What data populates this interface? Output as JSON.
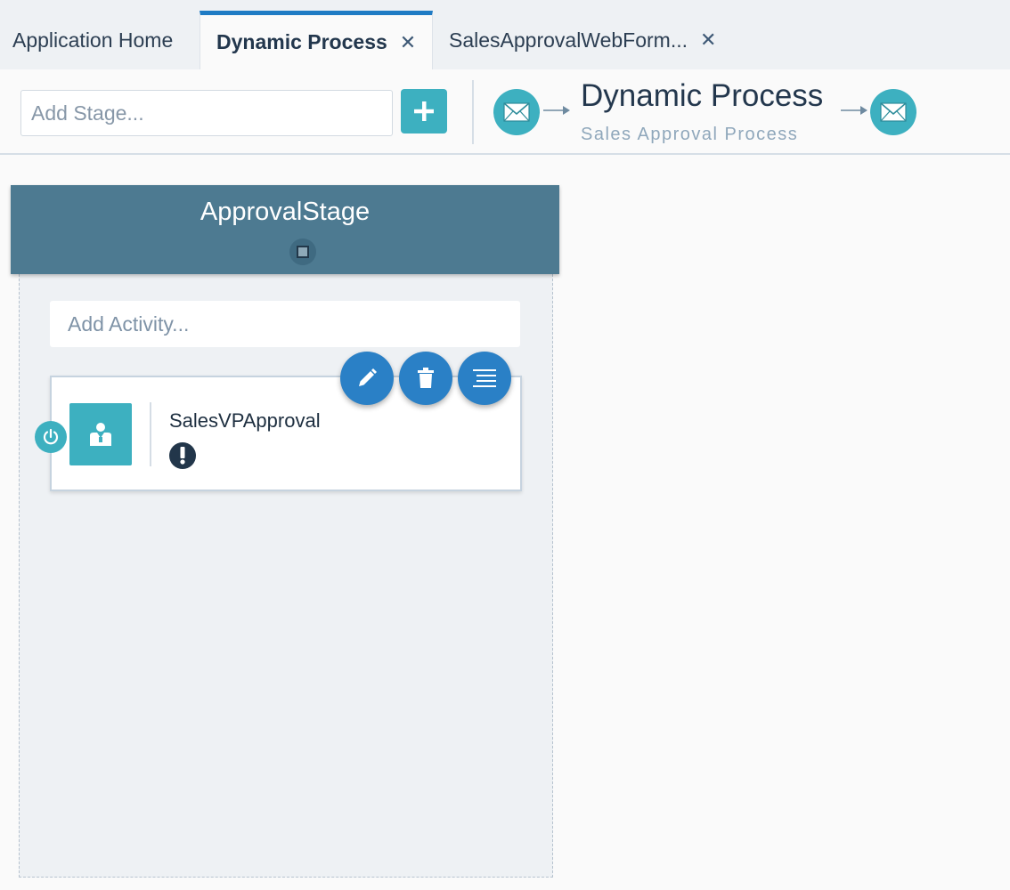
{
  "tabs": [
    {
      "label": "Application Home",
      "closable": false
    },
    {
      "label": "Dynamic Process",
      "closable": true,
      "active": true
    },
    {
      "label": "SalesApprovalWebForm...",
      "closable": true
    }
  ],
  "toolbar": {
    "stage_placeholder": "Add Stage...",
    "add_icon": "plus-icon"
  },
  "process": {
    "title": "Dynamic Process",
    "subtitle": "Sales Approval Process",
    "start_icon": "envelope-icon",
    "end_icon": "envelope-icon"
  },
  "stage": {
    "title": "ApprovalStage",
    "activity_placeholder": "Add Activity...",
    "activities": [
      {
        "name": "SalesVPApproval",
        "icon": "user-task-icon",
        "status_icon": "warning-icon"
      }
    ],
    "actions": [
      "pencil-icon",
      "trash-icon",
      "menu-lines-icon"
    ]
  },
  "colors": {
    "accent_teal": "#3db0c0",
    "action_blue": "#2a80c6",
    "stage_header": "#4d7a91",
    "active_tab_border": "#1f7bc4"
  }
}
